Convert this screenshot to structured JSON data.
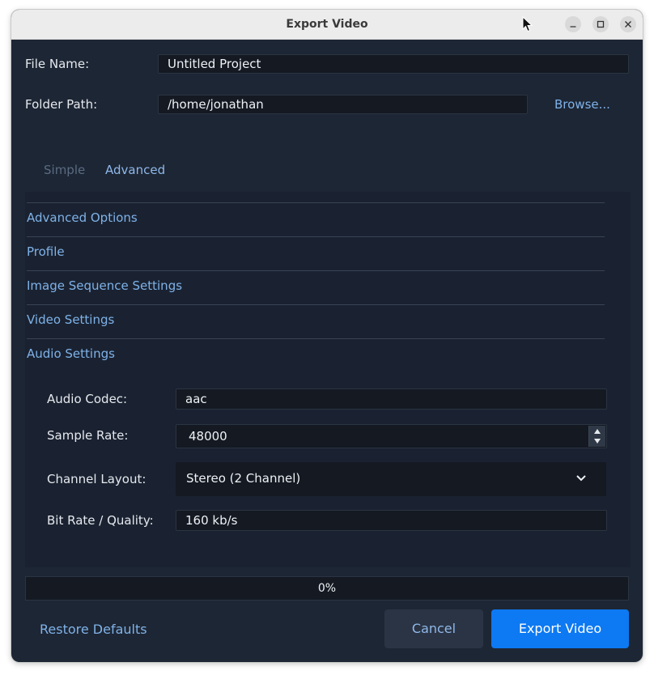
{
  "window": {
    "title": "Export Video"
  },
  "form": {
    "file_name_label": "File Name:",
    "file_name_value": "Untitled Project",
    "folder_path_label": "Folder Path:",
    "folder_path_value": "/home/jonathan",
    "browse_label": "Browse..."
  },
  "tabs": [
    {
      "label": "Simple",
      "active": false
    },
    {
      "label": "Advanced",
      "active": true
    }
  ],
  "sections": [
    {
      "label": "Advanced Options"
    },
    {
      "label": "Profile"
    },
    {
      "label": "Image Sequence Settings"
    },
    {
      "label": "Video Settings"
    },
    {
      "label": "Audio Settings"
    }
  ],
  "audio": {
    "codec_label": "Audio Codec:",
    "codec_value": "aac",
    "sample_rate_label": "Sample Rate:",
    "sample_rate_value": "48000",
    "channel_layout_label": "Channel Layout:",
    "channel_layout_value": "Stereo (2 Channel)",
    "bitrate_label": "Bit Rate / Quality:",
    "bitrate_value": "160 kb/s"
  },
  "progress": {
    "text": "0%",
    "value": 0
  },
  "footer": {
    "restore_label": "Restore Defaults",
    "cancel_label": "Cancel",
    "export_label": "Export Video"
  },
  "colors": {
    "window_bg": "#1d2634",
    "panel_bg": "#1a2231",
    "field_bg": "#141922",
    "link": "#7fb2e8",
    "primary_button": "#0d79f2",
    "secondary_button": "#2b3444"
  },
  "icons": {
    "minimize": "minimize-icon",
    "maximize": "maximize-icon",
    "close": "close-icon",
    "dropdown": "chevron-down-icon",
    "spin_up": "triangle-up-icon",
    "spin_down": "triangle-down-icon",
    "cursor": "mouse-pointer-icon"
  }
}
